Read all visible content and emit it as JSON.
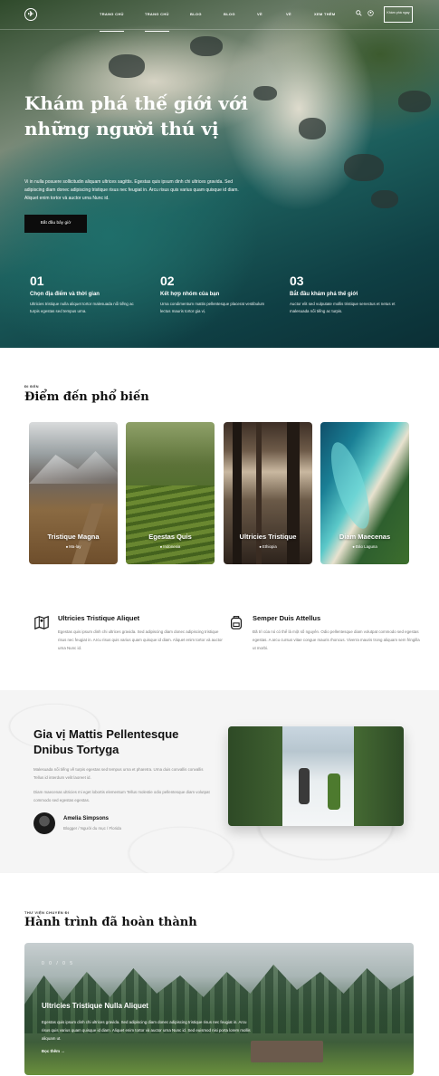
{
  "nav": {
    "items": [
      "TRANG CHỦ",
      "TRANG CHỦ",
      "BLOG",
      "BLOG",
      "VỀ",
      "VỀ",
      "XEM THÊM"
    ],
    "cta": "Khám phá ngay",
    "icons": [
      "search-icon",
      "user-icon"
    ]
  },
  "hero": {
    "title": "Khám phá thế giới với những người thú vị",
    "description": "Vi in nulla posuere sollicitudin aliquam ultrices sagittis. Egestas quis ipsum dinh chi ultrices gravida. Sed adipiscing diam donec adipiscing tristique risus nec feugiat in. Arcu risus quis varius quam quisque id diam. Aliquet enim tortor và auctor urna Nunc id.",
    "button": "Bắt đầu bây giờ",
    "steps": [
      {
        "num": "01",
        "title": "Chọn địa điểm và thời gian",
        "desc": "Ultricies tristique nulla aliquet tortor malesuada nổi tiếng ac turpis egestas sed tempus urna."
      },
      {
        "num": "02",
        "title": "Kết hợp nhóm của bạn",
        "desc": "Urna condimentum mattis pellentesque placerat vestibulum lectus mauris tortor gia vị."
      },
      {
        "num": "03",
        "title": "Bắt đầu khám phá thế giới",
        "desc": "Auctor elit sed vulputate mollis tristique senectus et netus et malesuada nổi tiếng ac turpis."
      }
    ]
  },
  "destinations": {
    "kicker": "ĐI ĐẾN",
    "title": "Điểm đến phổ biến",
    "cards": [
      {
        "name": "Tristique Magna",
        "location": "Ma-lay"
      },
      {
        "name": "Egestas Quis",
        "location": "Indonesia"
      },
      {
        "name": "Ultricies Tristique",
        "location": "Ethiopia"
      },
      {
        "name": "Diam Maecenas",
        "location": "Đảo Laguna"
      }
    ]
  },
  "features": [
    {
      "title": "Ultricies Tristique Aliquet",
      "desc": "Egestas quis ipsum dinh chi ultrices gravida. Sed adipiscing diam donec adipiscing tristique risus nec feugiat in. Arcu risus quis varius quam quisque id diam. Aliquet enim tortor và auctor urna Nunc id.",
      "icon": "map-icon"
    },
    {
      "title": "Semper Duis Attellus",
      "desc": "Đã trì của nó có thể là một số nguyên. Odio pellentesque diam volutpat commodo sed egestas egestas. A arcu cursus vitae congue mauris rhoncus. Viverra mauris trong aliquam sem fringilla ut morbi.",
      "icon": "backpack-icon"
    }
  ],
  "testimonial": {
    "title": "Gia vị Mattis Pellentesque Dnibus Tortyga",
    "p1": "Malesuada nổi tiếng về turpis egestas sed tempus urna et pharetra. Urna duis convallis convallis Tellus id interdum velit laoreet id.",
    "p2": "Diam maecenas ultricies mi eget lobortis elementum Tellus molestie odio pellentesque diam volutpat commodo sed egestas egestas.",
    "author_name": "Amelia Simpsons",
    "author_role": "Blogger / Người du mục / Florida"
  },
  "journey": {
    "kicker": "THƯ VIỆN CHUYẾN ĐI",
    "title": "Hành trình đã hoàn thành",
    "counter": "0 0 / 0 5",
    "card_title": "Ultricies Tristique Nulla Aliquet",
    "card_desc": "Egestas quis ipsum dinh chi ultrices gravida. Sed adipiscing diam donec adipiscing tristique risus nec feugiat in. Arcu risus quis varius quam quisque id diam. Aliquet enim tortor và auctor urna Nunc id. Sed euismod nisi porta lorem mollis aliquam ut.",
    "link": "Đọc thêm"
  },
  "colors": {
    "accent": "#0c0c0c",
    "teal": "#1c5e5c",
    "muted": "#888888"
  }
}
